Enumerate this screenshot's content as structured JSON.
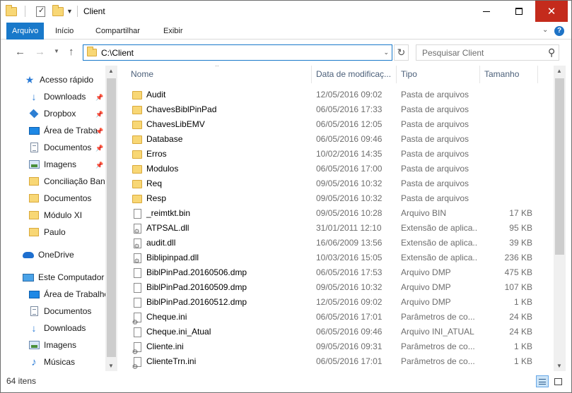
{
  "title_bar": {
    "title": "Client",
    "minimize": "minimize",
    "maximize": "maximize",
    "close": "close"
  },
  "ribbon": {
    "tabs": [
      {
        "label": "Arquivo"
      },
      {
        "label": "Início"
      },
      {
        "label": "Compartilhar"
      },
      {
        "label": "Exibir"
      }
    ]
  },
  "address": {
    "path": "C:\\Client"
  },
  "search": {
    "placeholder": "Pesquisar Client"
  },
  "nav": {
    "items": [
      {
        "label": "Acesso rápido",
        "icon": "star-icon",
        "pinned": false
      },
      {
        "label": "Downloads",
        "icon": "download-icon",
        "pinned": true
      },
      {
        "label": "Dropbox",
        "icon": "dropbox-icon",
        "pinned": true
      },
      {
        "label": "Área de Traba",
        "icon": "desktop-icon",
        "pinned": true
      },
      {
        "label": "Documentos",
        "icon": "document-icon",
        "pinned": true
      },
      {
        "label": "Imagens",
        "icon": "image-icon",
        "pinned": true
      },
      {
        "label": "Conciliação Ban",
        "icon": "folder-icon",
        "pinned": false
      },
      {
        "label": "Documentos",
        "icon": "folder-icon",
        "pinned": false
      },
      {
        "label": "Módulo XI",
        "icon": "folder-icon",
        "pinned": false
      },
      {
        "label": "Paulo",
        "icon": "folder-icon",
        "pinned": false
      },
      {
        "label": "OneDrive",
        "icon": "onedrive-icon",
        "pinned": false
      },
      {
        "label": "Este Computador",
        "icon": "computer-icon",
        "pinned": false
      },
      {
        "label": "Área de Trabalho",
        "icon": "desktop-icon",
        "pinned": false
      },
      {
        "label": "Documentos",
        "icon": "document-icon",
        "pinned": false
      },
      {
        "label": "Downloads",
        "icon": "download-icon",
        "pinned": false
      },
      {
        "label": "Imagens",
        "icon": "image-icon",
        "pinned": false
      },
      {
        "label": "Músicas",
        "icon": "music-icon",
        "pinned": false
      }
    ]
  },
  "columns": {
    "name": "Nome",
    "date": "Data de modificaç...",
    "type": "Tipo",
    "size": "Tamanho"
  },
  "files": [
    {
      "name": "Audit",
      "date": "12/05/2016 09:02",
      "type": "Pasta de arquivos",
      "size": "",
      "kind": "folder"
    },
    {
      "name": "ChavesBiblPinPad",
      "date": "06/05/2016 17:33",
      "type": "Pasta de arquivos",
      "size": "",
      "kind": "folder"
    },
    {
      "name": "ChavesLibEMV",
      "date": "06/05/2016 12:05",
      "type": "Pasta de arquivos",
      "size": "",
      "kind": "folder"
    },
    {
      "name": "Database",
      "date": "06/05/2016 09:46",
      "type": "Pasta de arquivos",
      "size": "",
      "kind": "folder"
    },
    {
      "name": "Erros",
      "date": "10/02/2016 14:35",
      "type": "Pasta de arquivos",
      "size": "",
      "kind": "folder"
    },
    {
      "name": "Modulos",
      "date": "06/05/2016 17:00",
      "type": "Pasta de arquivos",
      "size": "",
      "kind": "folder"
    },
    {
      "name": "Req",
      "date": "09/05/2016 10:32",
      "type": "Pasta de arquivos",
      "size": "",
      "kind": "folder"
    },
    {
      "name": "Resp",
      "date": "09/05/2016 10:32",
      "type": "Pasta de arquivos",
      "size": "",
      "kind": "folder"
    },
    {
      "name": "_reimtkt.bin",
      "date": "09/05/2016 10:28",
      "type": "Arquivo BIN",
      "size": "17 KB",
      "kind": "file"
    },
    {
      "name": "ATPSAL.dll",
      "date": "31/01/2011 12:10",
      "type": "Extensão de aplica...",
      "size": "95 KB",
      "kind": "dll"
    },
    {
      "name": "audit.dll",
      "date": "16/06/2009 13:56",
      "type": "Extensão de aplica...",
      "size": "39 KB",
      "kind": "dll"
    },
    {
      "name": "Biblipinpad.dll",
      "date": "10/03/2016 15:05",
      "type": "Extensão de aplica...",
      "size": "236 KB",
      "kind": "dll"
    },
    {
      "name": "BiblPinPad.20160506.dmp",
      "date": "06/05/2016 17:53",
      "type": "Arquivo DMP",
      "size": "475 KB",
      "kind": "file"
    },
    {
      "name": "BiblPinPad.20160509.dmp",
      "date": "09/05/2016 10:32",
      "type": "Arquivo DMP",
      "size": "107 KB",
      "kind": "file"
    },
    {
      "name": "BiblPinPad.20160512.dmp",
      "date": "12/05/2016 09:02",
      "type": "Arquivo DMP",
      "size": "1 KB",
      "kind": "file"
    },
    {
      "name": "Cheque.ini",
      "date": "06/05/2016 17:01",
      "type": "Parâmetros de co...",
      "size": "24 KB",
      "kind": "ini"
    },
    {
      "name": "Cheque.ini_Atual",
      "date": "06/05/2016 09:46",
      "type": "Arquivo INI_ATUAL",
      "size": "24 KB",
      "kind": "file"
    },
    {
      "name": "Cliente.ini",
      "date": "09/05/2016 09:31",
      "type": "Parâmetros de co...",
      "size": "1 KB",
      "kind": "ini"
    },
    {
      "name": "ClienteTrn.ini",
      "date": "06/05/2016 17:01",
      "type": "Parâmetros de co...",
      "size": "1 KB",
      "kind": "ini"
    }
  ],
  "status": {
    "count": "64 itens"
  }
}
